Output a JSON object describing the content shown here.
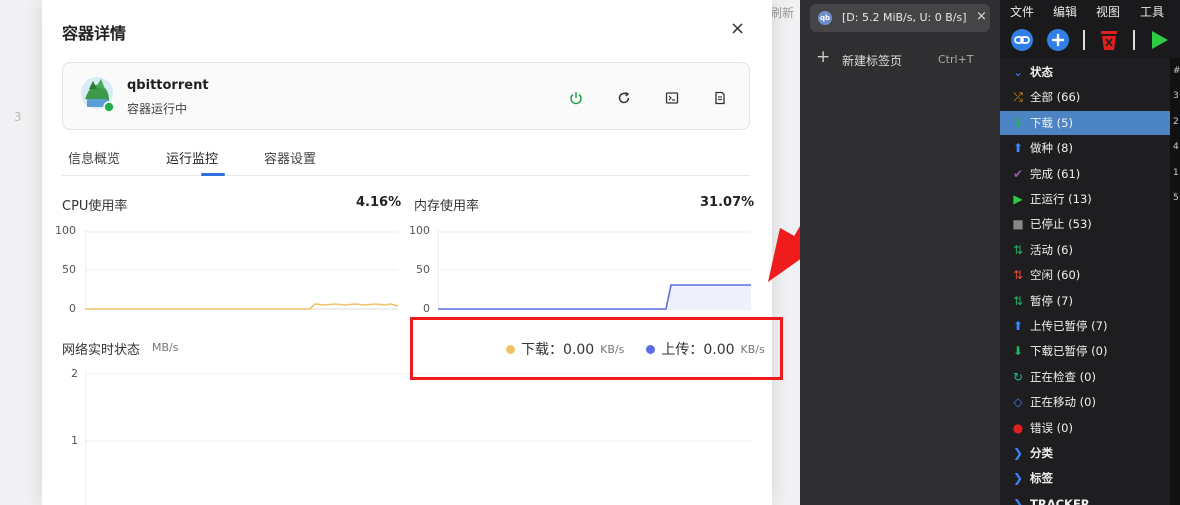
{
  "background": {
    "refresh_text": "刷新",
    "left_number": "3"
  },
  "modal": {
    "title": "容器详情",
    "close_glyph": "×",
    "app": {
      "name": "qbittorrent",
      "status": "容器运行中"
    },
    "tabs": [
      {
        "label": "信息概览"
      },
      {
        "label": "运行监控"
      },
      {
        "label": "容器设置"
      }
    ],
    "cpu": {
      "label": "CPU使用率",
      "value": "4.16%",
      "axis": [
        "100",
        "50",
        "0"
      ]
    },
    "memory": {
      "label": "内存使用率",
      "value": "31.07%",
      "axis": [
        "100",
        "50",
        "0"
      ]
    },
    "network": {
      "title": "网络实时状态",
      "unit": "MB/s",
      "axis": [
        "2",
        "1"
      ],
      "download": {
        "label": "下载：0.00",
        "unit": "KB/s",
        "color": "#f0c36a"
      },
      "upload": {
        "label": "上传：0.00",
        "unit": "KB/s",
        "color": "#5b6de0"
      }
    }
  },
  "browser": {
    "tab_title": "[D: 5.2 MiB/s, U: 0 B/s]",
    "tab_icon": "qb",
    "close_glyph": "×",
    "new_tab_label": "新建标签页",
    "new_tab_shortcut": "Ctrl+T"
  },
  "qbittorrent": {
    "menu": [
      "文件",
      "编辑",
      "视图",
      "工具"
    ],
    "sidebar": [
      {
        "label": "状态",
        "icon": "chevron-down-icon",
        "color": "#3a86ff",
        "head": true
      },
      {
        "label": "全部 (66)",
        "icon": "shuffle-icon",
        "color": "#f39c12"
      },
      {
        "label": "下载 (5)",
        "icon": "double-down-icon",
        "color": "#27ae60",
        "selected": true
      },
      {
        "label": "做种 (8)",
        "icon": "double-up-icon",
        "color": "#3a86ff"
      },
      {
        "label": "完成 (61)",
        "icon": "check-icon",
        "color": "#9b59b6"
      },
      {
        "label": "正运行 (13)",
        "icon": "play-icon",
        "color": "#2ecc40"
      },
      {
        "label": "已停止 (53)",
        "icon": "stop-icon",
        "color": "#888888"
      },
      {
        "label": "活动 (6)",
        "icon": "updown-green-icon",
        "color": "#27ae60"
      },
      {
        "label": "空闲 (60)",
        "icon": "updown-red-icon",
        "color": "#e74c3c"
      },
      {
        "label": "暂停 (7)",
        "icon": "updown-teal-icon",
        "color": "#27ae60"
      },
      {
        "label": "上传已暂停 (7)",
        "icon": "double-up-icon",
        "color": "#3a86ff"
      },
      {
        "label": "下载已暂停 (0)",
        "icon": "double-down-icon",
        "color": "#27ae60"
      },
      {
        "label": "正在检查 (0)",
        "icon": "refresh-icon",
        "color": "#1abc9c"
      },
      {
        "label": "正在移动 (0)",
        "icon": "move-icon",
        "color": "#3a86ff"
      },
      {
        "label": "错误 (0)",
        "icon": "error-icon",
        "color": "#e02020"
      },
      {
        "label": "分类",
        "icon": "chevron-right-icon",
        "color": "#3a86ff",
        "head": true
      },
      {
        "label": "标签",
        "icon": "chevron-right-icon",
        "color": "#3a86ff",
        "head": true
      },
      {
        "label": "TRACKER",
        "icon": "chevron-right-icon",
        "color": "#3a86ff",
        "head": true
      }
    ],
    "right_numbers": [
      "#",
      "3",
      "2",
      "4",
      "1",
      "5"
    ]
  }
}
